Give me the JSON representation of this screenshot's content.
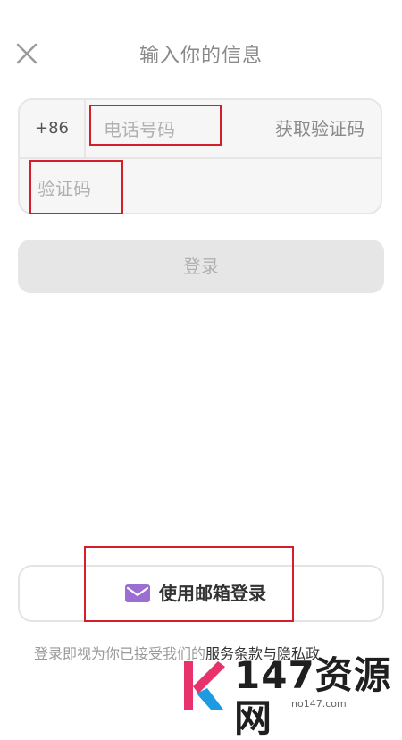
{
  "header": {
    "title": "输入你的信息",
    "close_icon": "close-icon"
  },
  "form": {
    "country_code": "+86",
    "phone_placeholder": "电话号码",
    "get_code_label": "获取验证码",
    "code_placeholder": "验证码"
  },
  "login_button": {
    "label": "登录"
  },
  "email_login": {
    "icon": "mail-icon",
    "label": "使用邮箱登录",
    "icon_color": "#9b6fd1"
  },
  "terms": {
    "prefix": "登录即视为你已接受我们的",
    "link": "服务条款与隐私政"
  },
  "watermark": {
    "brand": "147资源网",
    "url": "no147.com"
  },
  "colors": {
    "accent": "#9b6fd1",
    "highlight": "#d21f2a",
    "button_disabled": "#e6e6e6"
  }
}
